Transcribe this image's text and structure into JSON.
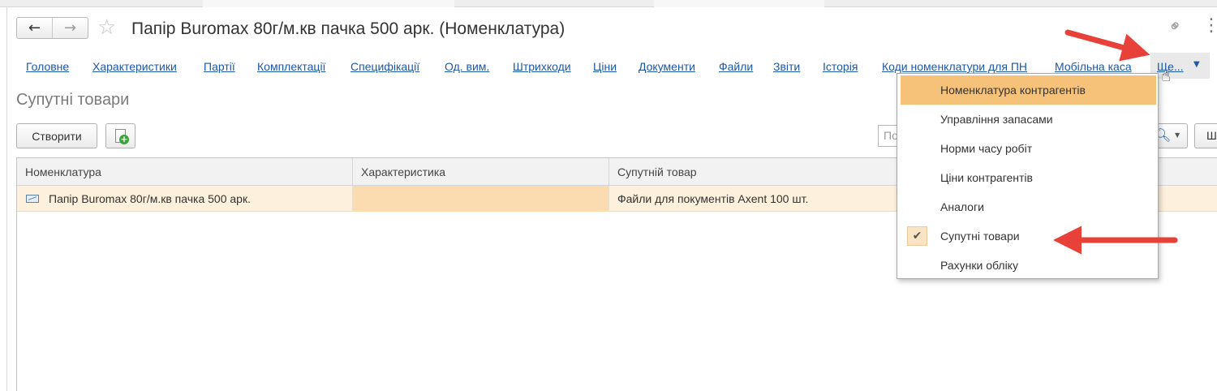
{
  "window": {
    "title": "Папір Buromax 80г/м.кв пачка 500 арк. (Номенклатура)"
  },
  "icons": {
    "back": "←",
    "forward": "→",
    "favorite": "☆",
    "link": "⚭",
    "more": "⋮"
  },
  "tabs": [
    {
      "label": "Головне"
    },
    {
      "label": "Характеристики"
    },
    {
      "label": "Партії"
    },
    {
      "label": "Комплектації"
    },
    {
      "label": "Специфікації"
    },
    {
      "label": "Од. вим."
    },
    {
      "label": "Штрихкоди"
    },
    {
      "label": "Ціни"
    },
    {
      "label": "Документи"
    },
    {
      "label": "Файли"
    },
    {
      "label": "Звіти"
    },
    {
      "label": "Історія"
    },
    {
      "label": "Коди номенклатури для ПН"
    },
    {
      "label": "Мобільна каса"
    }
  ],
  "tabs_more": {
    "label": "Ще...",
    "caret": "▼"
  },
  "section": {
    "title": "Супутні товари"
  },
  "toolbar": {
    "create_label": "Створити",
    "search_placeholder": "По",
    "search_caret": "▼",
    "sh_label": "Ш"
  },
  "grid": {
    "columns": [
      "Номенклатура",
      "Характеристика",
      "Супутній товар"
    ],
    "rows": [
      {
        "nomenclature": "Папір Buromax 80г/м.кв пачка 500 арк.",
        "characteristic": "",
        "related": "Файли для покументів Axent 100 шт."
      }
    ]
  },
  "dropdown": {
    "items": [
      {
        "label": "Номенклатура контрагентів",
        "state": "highlighted"
      },
      {
        "label": "Управління запасами",
        "state": ""
      },
      {
        "label": "Норми часу робіт",
        "state": ""
      },
      {
        "label": "Ціни контрагентів",
        "state": ""
      },
      {
        "label": "Аналоги",
        "state": ""
      },
      {
        "label": "Супутні товари",
        "state": "checked"
      },
      {
        "label": "Рахунки обліку",
        "state": ""
      }
    ],
    "check_mark": "✔"
  },
  "colors": {
    "link": "#1c58a8",
    "highlight": "#f6c27a",
    "selected_row": "#fdf0dc",
    "annotation_arrow": "#e8413a"
  }
}
